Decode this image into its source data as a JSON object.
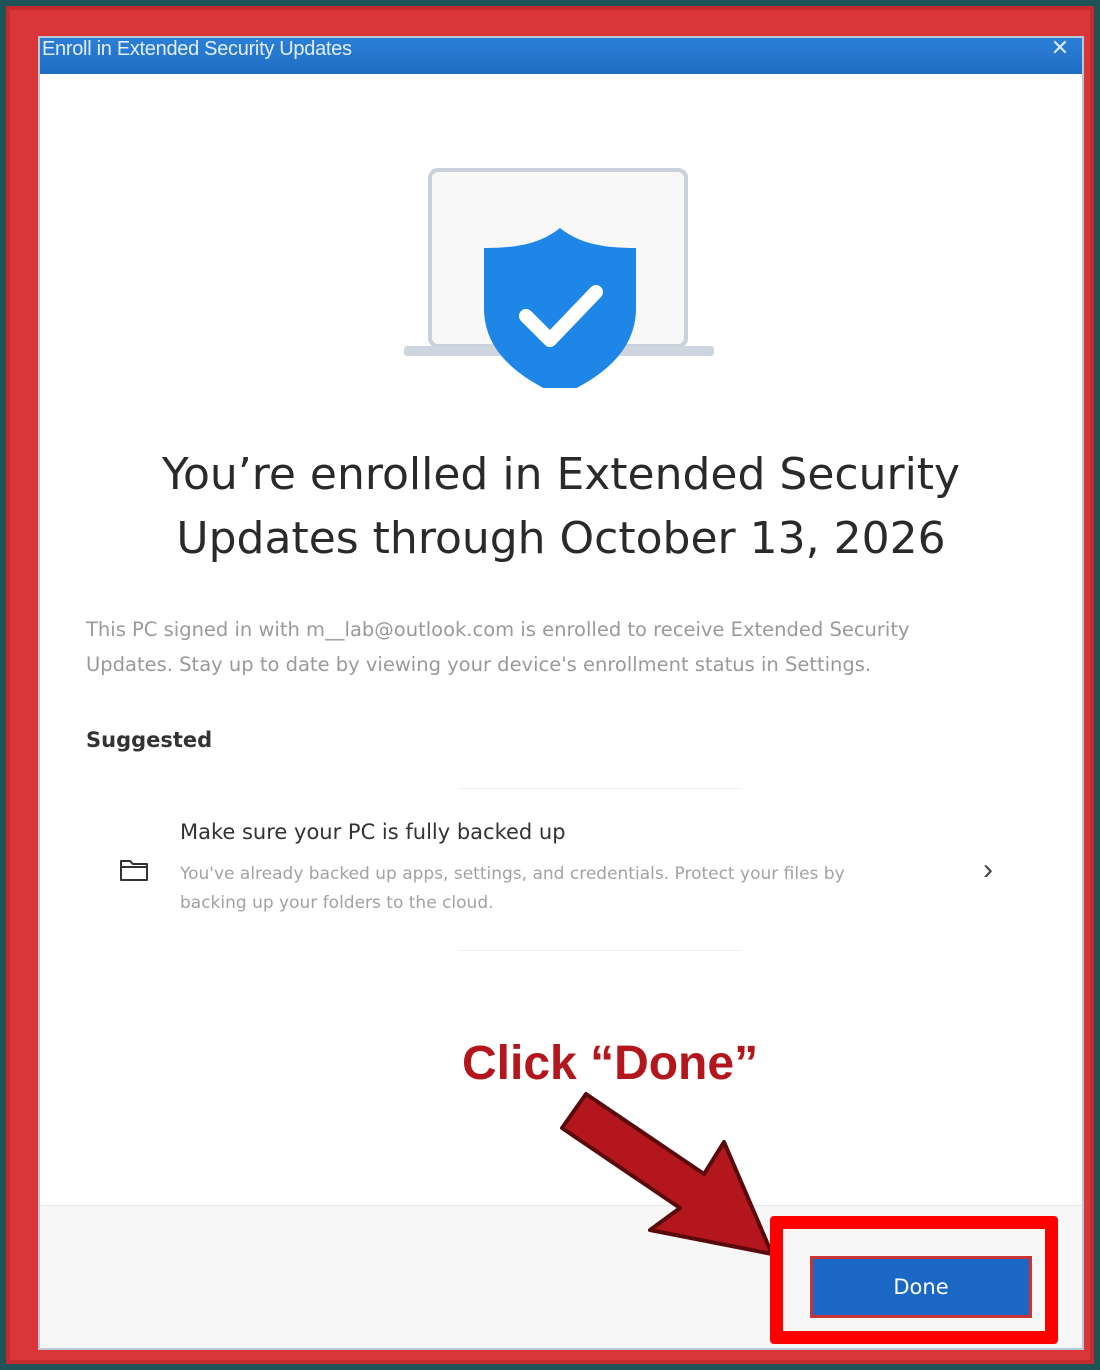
{
  "window": {
    "title": "Enroll in Extended Security Updates",
    "close_glyph": "✕"
  },
  "hero": {
    "illustration": "laptop-with-shield-checkmark",
    "colors": {
      "laptop": "#c9d2dc",
      "shield": "#1e86e6",
      "check": "#ffffff"
    }
  },
  "content": {
    "headline_line1": "You’re enrolled in Extended Security",
    "headline_line2": "Updates through October 13, 2026",
    "body_line1": "This PC signed in with m__lab@outlook.com is enrolled to receive Extended Security",
    "body_line2": "Updates. Stay up to date by viewing your device's enrollment status in Settings.",
    "suggested_label": "Suggested",
    "suggestion": {
      "icon": "folder-icon",
      "title": "Make sure your PC is fully backed up",
      "desc_line1": "You've already backed up apps, settings, and credentials. Protect your files by",
      "desc_line2": "backing up your folders to the cloud.",
      "chevron_glyph": "›"
    }
  },
  "footer": {
    "done_label": "Done"
  },
  "annotation": {
    "text": "Click “Done”",
    "color": "#b3161c",
    "highlight_color": "#ff0000"
  }
}
